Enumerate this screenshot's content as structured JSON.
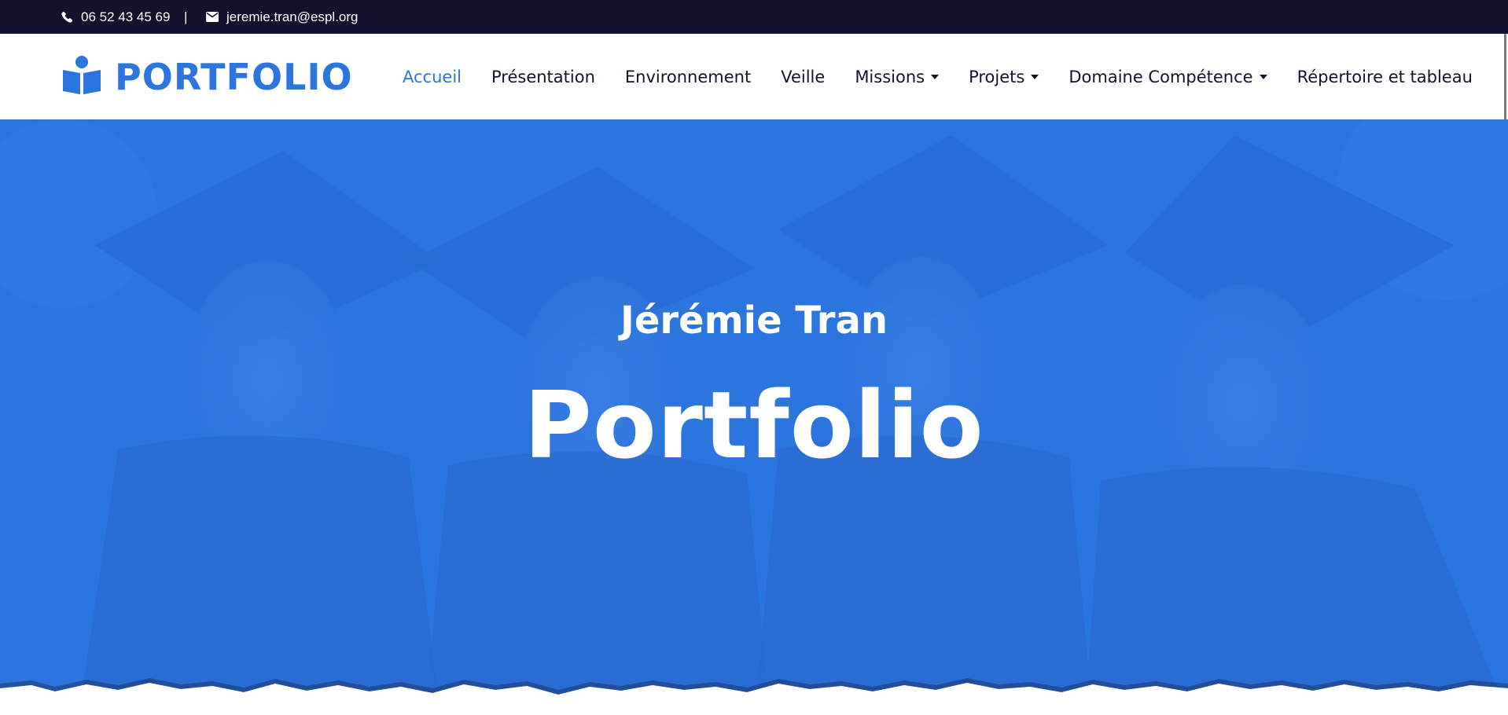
{
  "topbar": {
    "phone": "06 52 43 45 69",
    "separator": "|",
    "email": "jeremie.tran@espl.org",
    "phone_icon": "phone-icon",
    "email_icon": "envelope-icon"
  },
  "brand": {
    "logo_icon": "reader-book-icon",
    "name": "PORTFOLIO"
  },
  "nav": {
    "items": [
      {
        "label": "Accueil",
        "active": true,
        "dropdown": false
      },
      {
        "label": "Présentation",
        "active": false,
        "dropdown": false
      },
      {
        "label": "Environnement",
        "active": false,
        "dropdown": false
      },
      {
        "label": "Veille",
        "active": false,
        "dropdown": false
      },
      {
        "label": "Missions",
        "active": false,
        "dropdown": true
      },
      {
        "label": "Projets",
        "active": false,
        "dropdown": true
      },
      {
        "label": "Domaine Compétence",
        "active": false,
        "dropdown": true
      },
      {
        "label": "Répertoire et tableau",
        "active": false,
        "dropdown": false
      }
    ]
  },
  "hero": {
    "subtitle": "Jérémie Tran",
    "title": "Portfolio"
  },
  "colors": {
    "topbar_bg": "#12112e",
    "accent": "#2b75dd",
    "nav_text": "#12112e",
    "hero_overlay": "#2f78e6"
  }
}
